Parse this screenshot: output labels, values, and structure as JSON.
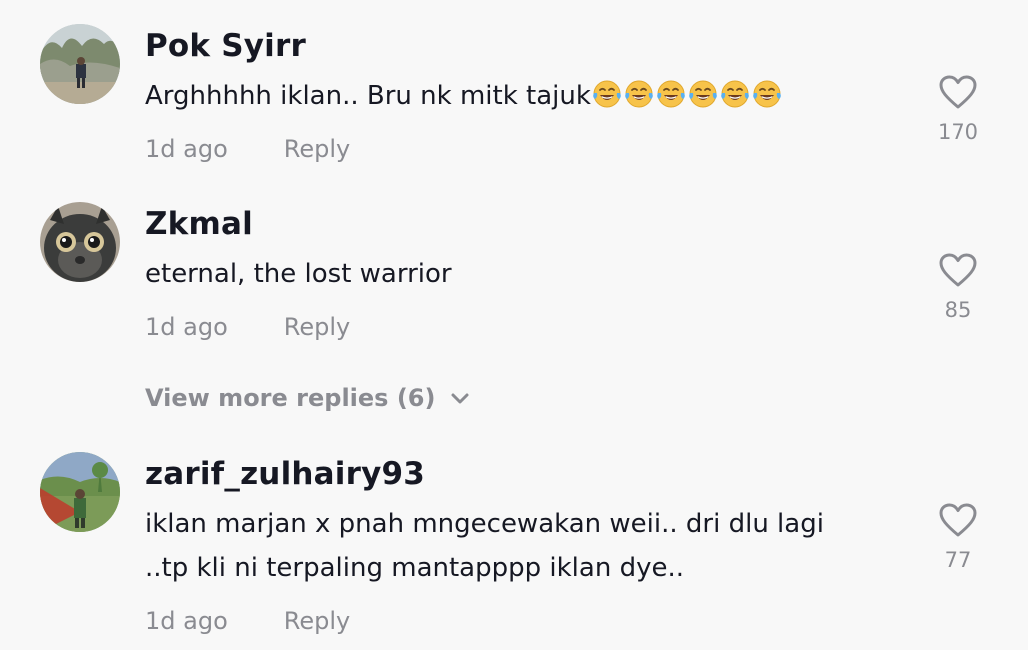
{
  "comments": [
    {
      "username": "Pok Syirr",
      "text": "Arghhhhh iklan.. Bru nk mitk tajuk",
      "emoji": "face-with-tears-of-joy-icon",
      "emoji_count": 6,
      "time": "1d ago",
      "reply_label": "Reply",
      "likes": "170"
    },
    {
      "username": "Zkmal",
      "text": "eternal, the lost warrior",
      "time": "1d ago",
      "reply_label": "Reply",
      "likes": "85"
    },
    {
      "username": "zarif_zulhairy93",
      "text_line1": "iklan marjan x pnah mngecewakan weii.. dri dlu lagi",
      "text_line2": "..tp kli ni terpaling mantapppp iklan dye..",
      "time": "1d ago",
      "reply_label": "Reply",
      "likes": "77"
    }
  ],
  "view_more_replies": "View more replies (6)",
  "colors": {
    "background": "#f8f8f8",
    "primary_text": "#161823",
    "secondary_text": "#8a8b91"
  }
}
